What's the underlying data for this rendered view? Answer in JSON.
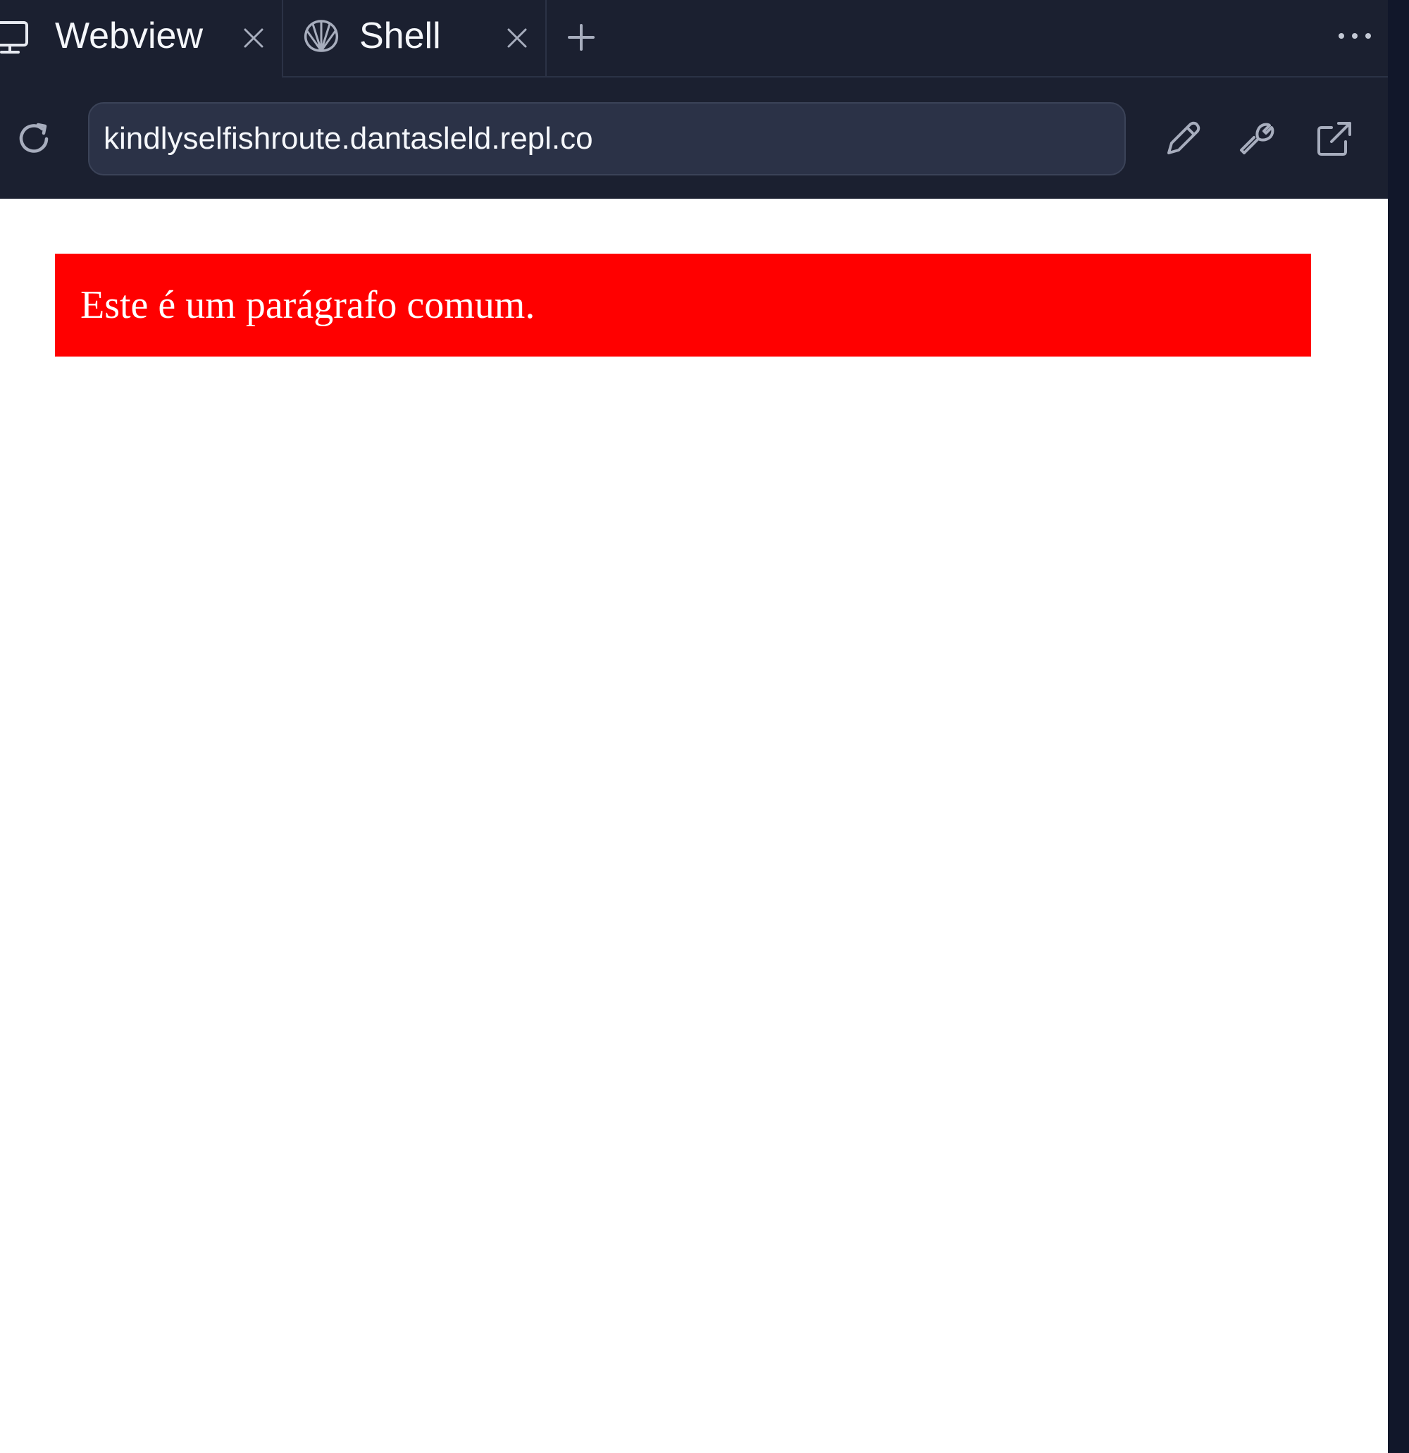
{
  "tabs": [
    {
      "label": "Webview",
      "icon": "monitor-icon",
      "active": true
    },
    {
      "label": "Shell",
      "icon": "shell-icon",
      "active": false
    }
  ],
  "address_bar": {
    "url": "kindlyselfishroute.dantasleld.repl.co"
  },
  "webview": {
    "paragraph": "Este é um parágrafo comum."
  },
  "colors": {
    "chrome_background": "#1b2030",
    "url_field_background": "#2b3247",
    "paragraph_background": "#ff0000",
    "paragraph_text": "#ffffff",
    "page_background": "#ffffff"
  }
}
